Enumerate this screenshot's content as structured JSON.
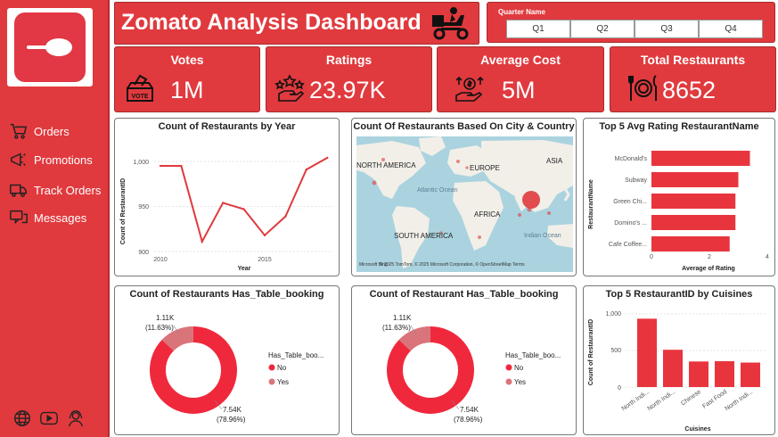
{
  "header": {
    "title": "Zomato Analysis Dashboard",
    "quarter_label": "Quarter Name",
    "quarters": [
      "Q1",
      "Q2",
      "Q3",
      "Q4"
    ]
  },
  "sidebar": {
    "items": [
      {
        "label": "Orders",
        "icon": "cart-icon"
      },
      {
        "label": "Promotions",
        "icon": "megaphone-icon"
      },
      {
        "label": "Track Orders",
        "icon": "truck-icon"
      },
      {
        "label": "Messages",
        "icon": "chat-icon"
      }
    ],
    "bottom_icons": [
      "globe-icon",
      "youtube-icon",
      "support-agent-icon"
    ]
  },
  "kpis": {
    "votes": {
      "title": "Votes",
      "value": "1M"
    },
    "ratings": {
      "title": "Ratings",
      "value": "23.97K"
    },
    "avg_cost": {
      "title": "Average Cost",
      "value": "5M"
    },
    "total_restaurants": {
      "title": "Total Restaurants",
      "value": "8652"
    }
  },
  "colors": {
    "brand": "#e03a3e",
    "bar": "#e8353d",
    "donut_no": "#f0283c",
    "donut_yes": "#d9757a"
  },
  "chart_data": [
    {
      "type": "line",
      "title": "Count of Restaurants by Year",
      "xlabel": "Year",
      "ylabel": "Count of RestaurantID",
      "x": [
        2010,
        2011,
        2012,
        2013,
        2014,
        2015,
        2016,
        2017,
        2018
      ],
      "values": [
        995,
        995,
        911,
        954,
        947,
        918,
        939,
        991,
        1004
      ],
      "ylim": [
        900,
        1010
      ],
      "xticks": [
        "2010",
        "2015"
      ],
      "yticks": [
        "900",
        "950",
        "1,000"
      ]
    },
    {
      "type": "map",
      "title": "Count Of Restaurants Based On City & Country",
      "labels": [
        "NORTH AMERICA",
        "EUROPE",
        "ASIA",
        "Atlantic Ocean",
        "AFRICA",
        "SOUTH AMERICA",
        "Indian Ocean"
      ],
      "attribution": "© 2025 TomTom, © 2025 Microsoft Corporation, © OpenStreetMap  Terms",
      "logo": "Microsoft Bing"
    },
    {
      "type": "bar",
      "orientation": "horizontal",
      "title": "Top 5 Avg Rating RestaurantName",
      "xlabel": "Average of Rating",
      "ylabel": "RestaurantName",
      "categories": [
        "McDonald's",
        "Subway",
        "Green Chi...",
        "Domino's ...",
        "Cafe Coffee..."
      ],
      "values": [
        3.4,
        3.0,
        2.9,
        2.9,
        2.7
      ],
      "xlim": [
        0,
        4
      ],
      "xticks": [
        "0",
        "2",
        "4"
      ]
    },
    {
      "type": "donut",
      "title": "Count of Restaurants Has_Table_booking",
      "legend_title": "Has_Table_boo...",
      "slices": [
        {
          "name": "No",
          "value": 7540,
          "label": "7.54K",
          "pct": "(78.96%)"
        },
        {
          "name": "Yes",
          "value": 1110,
          "label": "1.11K",
          "pct": "(11.63%)"
        }
      ]
    },
    {
      "type": "donut",
      "title": "Count of Restaurant Has_Table_booking",
      "legend_title": "Has_Table_boo...",
      "slices": [
        {
          "name": "No",
          "value": 7540,
          "label": "7.54K",
          "pct": "(78.96%)"
        },
        {
          "name": "Yes",
          "value": 1110,
          "label": "1.11K",
          "pct": "(11.63%)"
        }
      ]
    },
    {
      "type": "bar",
      "title": "Top 5 RestaurantID by Cuisines",
      "xlabel": "Cuisines",
      "ylabel": "Count of RestaurantID",
      "categories": [
        "North Indi...",
        "North Indi...",
        "Chinese",
        "Fast Food",
        "North Indi..."
      ],
      "values": [
        935,
        510,
        350,
        354,
        335
      ],
      "ylim": [
        0,
        1000
      ],
      "yticks": [
        "0",
        "500",
        "1,000"
      ]
    }
  ]
}
